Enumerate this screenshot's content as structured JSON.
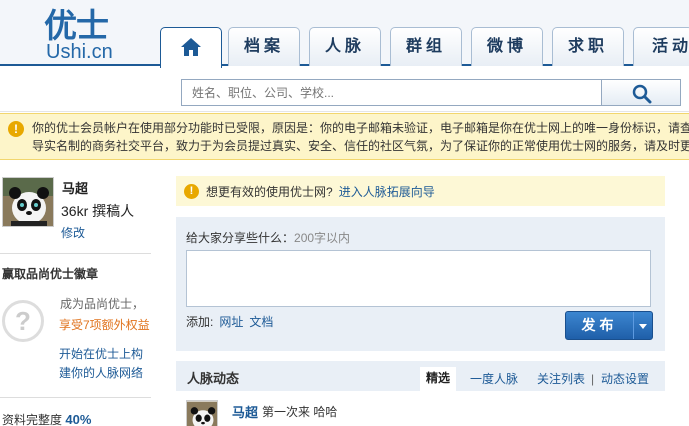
{
  "logo": {
    "cn": "优士",
    "en": "Ushi.cn"
  },
  "nav": {
    "tabs": [
      {
        "label": "",
        "icon": "home-icon"
      },
      {
        "label": "档案"
      },
      {
        "label": "人脉"
      },
      {
        "label": "群组"
      },
      {
        "label": "微博"
      },
      {
        "label": "求职"
      },
      {
        "label": "活动"
      }
    ]
  },
  "search": {
    "placeholder": "姓名、职位、公司、学校...",
    "icon": "search-icon"
  },
  "warning": {
    "line1": "你的优士会员帐户在使用部分功能时已受限，原因是：你的电子邮箱未验证，电子邮箱是你在优士网上的唯一身份标识，请查",
    "line2": "导实名制的商务社交平台，致力于为会员提过真实、安全、信任的社区气氛，为了保证你的正常使用优士网的服务，请及时更"
  },
  "profile": {
    "name": "马超",
    "title": "36kr 撰稿人",
    "edit_label": "修改"
  },
  "badge": {
    "heading": "赢取品尚优士徽章",
    "line1": "成为品尚优士，",
    "line2": "享受7项额外权益",
    "link": "开始在优士上构建你的人脉网络"
  },
  "completeness": {
    "label": "资料完整度",
    "value": "40%"
  },
  "tip": {
    "text": "想更有效的使用优士网?",
    "link": "进入人脉拓展向导"
  },
  "share": {
    "title": "给大家分享些什么：",
    "hint": "200字以内",
    "add_label": "添加:",
    "add_url": "网址",
    "add_doc": "文档",
    "publish_label": "发布"
  },
  "feed": {
    "title": "人脉动态",
    "tabs": [
      "精选",
      "一度人脉",
      "关注列表",
      "动态设置"
    ],
    "separator": "|",
    "items": [
      {
        "name": "马超",
        "text": "第一次来 哈哈"
      }
    ]
  },
  "colors": {
    "brand": "#1d5a96",
    "warning_bg": "#fdf5c9",
    "accent_orange": "#e0731d"
  }
}
